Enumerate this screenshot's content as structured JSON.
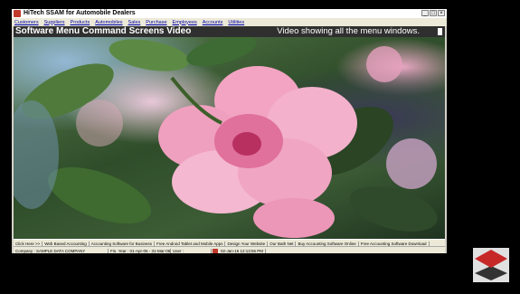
{
  "window": {
    "title": "HiTech SSAM for Automobile Dealers"
  },
  "menu": {
    "items": [
      {
        "label": "Customers"
      },
      {
        "label": "Suppliers"
      },
      {
        "label": "Products"
      },
      {
        "label": "Automobiles"
      },
      {
        "label": "Sales"
      },
      {
        "label": "Purchase"
      },
      {
        "label": "Employees"
      },
      {
        "label": "Accounts"
      },
      {
        "label": "Utilities"
      }
    ]
  },
  "banner": {
    "left_text": "Software Menu Command Screens Video",
    "right_text": "Video showing all the menu windows."
  },
  "taskbar": {
    "links": [
      {
        "label": "Click Here >>"
      },
      {
        "label": "Web Based Accounting"
      },
      {
        "label": "Accounting Software for Business"
      },
      {
        "label": "Free Android Tablet and Mobile Apps"
      },
      {
        "label": "Design Your Website"
      },
      {
        "label": "Our Bath Net"
      },
      {
        "label": "Buy Accounting Software Online"
      },
      {
        "label": "Free Accounting Software Download"
      }
    ]
  },
  "status": {
    "company": "Company : SAMPLE DATA COMPANY",
    "fin_year": "Fin. Year : 01-Apr-05 - 31-Mar-06",
    "user": "User :",
    "date": "02-Jan-16 12:13:56 PM"
  },
  "colors": {
    "banner_bg": "#2f2f2f",
    "menu_link": "#0000aa",
    "logo_red": "#c62828",
    "logo_dark": "#333333"
  }
}
